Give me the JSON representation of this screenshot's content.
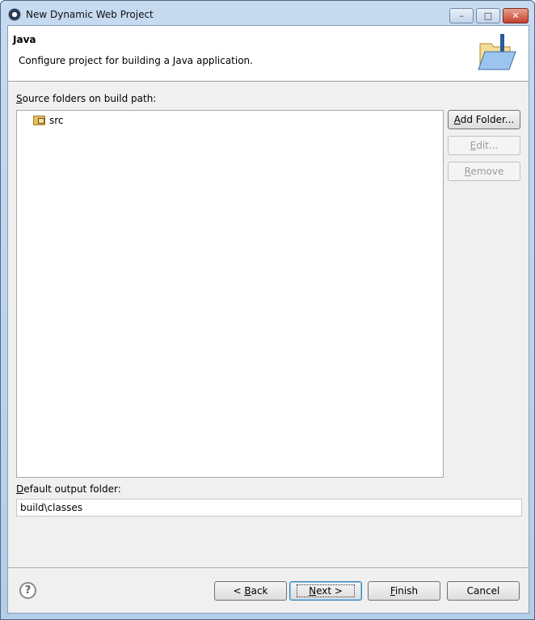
{
  "window": {
    "title": "New Dynamic Web Project",
    "minimize": "–",
    "maximize": "□",
    "close": "✕"
  },
  "header": {
    "title": "Java",
    "description": "Configure project for building a Java application.",
    "icon": "java-folder-icon"
  },
  "source_label": {
    "key": "S",
    "rest": "ource folders on build path:"
  },
  "tree": {
    "items": [
      {
        "label": "src",
        "icon": "source-folder-icon"
      }
    ]
  },
  "side_buttons": {
    "add": {
      "key": "A",
      "rest": "dd Folder..."
    },
    "edit": {
      "key": "E",
      "rest": "dit..."
    },
    "remove": {
      "key": "R",
      "rest": "emove"
    }
  },
  "output": {
    "label_key": "D",
    "label_rest": "efault output folder:",
    "value": "build\\classes"
  },
  "footer": {
    "help": "?",
    "back": {
      "prefix": "< ",
      "key": "B",
      "rest": "ack"
    },
    "next": {
      "key": "N",
      "rest": "ext >"
    },
    "finish": {
      "key": "F",
      "rest": "inish"
    },
    "cancel": "Cancel"
  }
}
